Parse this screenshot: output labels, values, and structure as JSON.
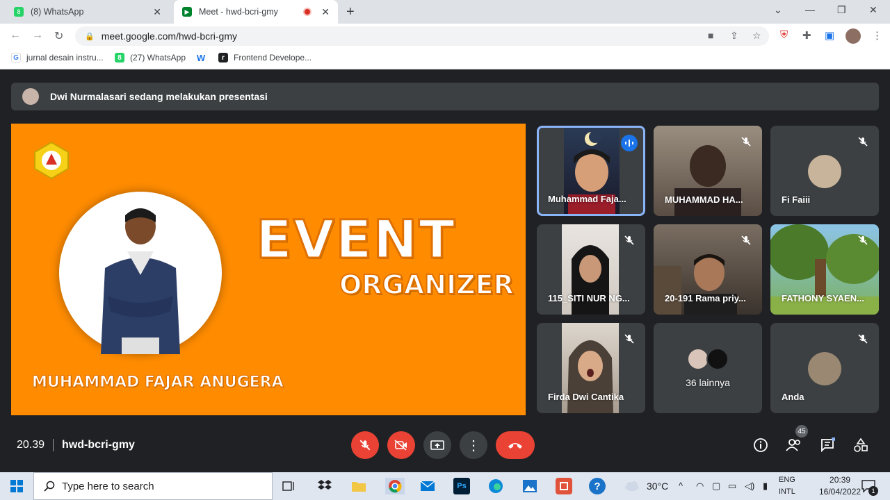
{
  "browser": {
    "tabs": [
      {
        "title": "(8) WhatsApp",
        "favicon": "whatsapp-icon",
        "active": false
      },
      {
        "title": "Meet - hwd-bcri-gmy",
        "favicon": "meet-icon",
        "active": true
      }
    ],
    "url": "meet.google.com/hwd-bcri-gmy",
    "bookmarks": [
      {
        "label": "jurnal desain instru...",
        "icon": "google-icon"
      },
      {
        "label": "(27) WhatsApp",
        "icon": "whatsapp-icon"
      },
      {
        "label": "",
        "icon": "w-logo-icon"
      },
      {
        "label": "Frontend Develope...",
        "icon": "frontend-icon"
      }
    ]
  },
  "meet": {
    "presenting_banner": "Dwi Nurmalasari sedang melakukan presentasi",
    "slide": {
      "title": "EVENT",
      "subtitle": "ORGANIZER",
      "presenter_name": "MUHAMMAD FAJAR ANUGERA"
    },
    "tiles": [
      {
        "name": "Muhammad Faja...",
        "muted": false,
        "speaking": true
      },
      {
        "name": "MUHAMMAD HA...",
        "muted": true
      },
      {
        "name": "Fi Faiii",
        "muted": true
      },
      {
        "name": "115_SITI NUR NG...",
        "muted": true
      },
      {
        "name": "20-191 Rama priy...",
        "muted": true
      },
      {
        "name": "FATHONY SYAEN...",
        "muted": true
      },
      {
        "name": "Firda Dwi Cantika",
        "muted": true
      },
      {
        "name": "36 lainnya",
        "muted": false
      },
      {
        "name": "Anda",
        "muted": true
      }
    ],
    "bottom": {
      "time": "20.39",
      "meeting_code": "hwd-bcri-gmy",
      "participant_count": "45"
    }
  },
  "taskbar": {
    "search_placeholder": "Type here to search",
    "weather": "30°C",
    "lang_top": "ENG",
    "lang_bottom": "INTL",
    "time": "20:39",
    "date": "16/04/2022",
    "notifications": "1"
  },
  "colors": {
    "accent_blue": "#1a73e8",
    "danger_red": "#ea4335",
    "slide_orange": "#ff8c00",
    "meet_bg": "#202124"
  }
}
